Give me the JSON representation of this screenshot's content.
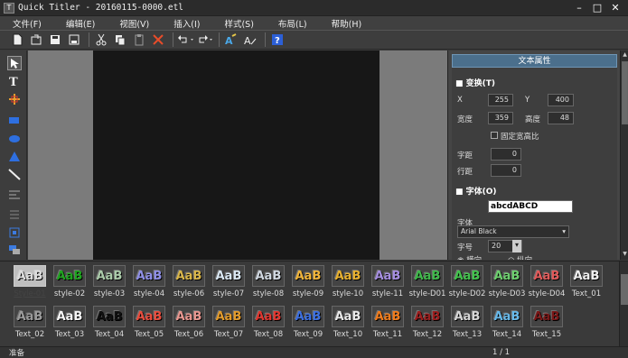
{
  "window": {
    "title": "Quick Titler - 20160115-0000.etl",
    "minimize": "–",
    "maximize": "□",
    "close": "✕"
  },
  "menu": [
    "文件(F)",
    "编辑(E)",
    "视图(V)",
    "插入(I)",
    "样式(S)",
    "布局(L)",
    "帮助(H)"
  ],
  "toolbar_icons": [
    "new-icon",
    "open-icon",
    "save-icon",
    "save-as-icon",
    "cut-icon",
    "copy-icon",
    "paste-icon",
    "delete-icon",
    "undo-icon",
    "redo-icon",
    "text-style-icon",
    "text-edit-icon",
    "help-icon"
  ],
  "left_tools": [
    "pointer-icon",
    "text-tool-icon",
    "crop-icon",
    "rectangle-icon",
    "ellipse-icon",
    "triangle-icon",
    "line-icon",
    "align-icon",
    "distribute-icon",
    "center-icon",
    "arrange-icon"
  ],
  "properties": {
    "header": "文本属性",
    "transform_section": "变换(T)",
    "x_label": "X",
    "x_value": "255",
    "y_label": "Y",
    "y_value": "400",
    "width_label": "宽度",
    "width_value": "359",
    "height_label": "高度",
    "height_value": "48",
    "fixed_ratio": "固定宽高比",
    "spacing_label": "字距",
    "spacing_value": "0",
    "line_label": "行距",
    "line_value": "0",
    "font_section": "字体(O)",
    "font_preview": "abcdABCD",
    "font_label": "字体",
    "font_value": "Arial Black",
    "size_label": "字号",
    "size_value": "20",
    "horizontal": "横向",
    "vertical": "纵向"
  },
  "styles_row1": [
    {
      "label": "Style-01",
      "text": "AaB",
      "color": "#dcdcdc",
      "selected": true
    },
    {
      "label": "style-02",
      "text": "AaB",
      "color": "#1fa31f"
    },
    {
      "label": "style-03",
      "text": "AaB",
      "color": "#aacaa9"
    },
    {
      "label": "style-04",
      "text": "AaB",
      "color": "#8f8fe6"
    },
    {
      "label": "style-06",
      "text": "AaB",
      "color": "#d9b64a"
    },
    {
      "label": "style-07",
      "text": "AaB",
      "color": "#d8e6f2"
    },
    {
      "label": "style-08",
      "text": "AaB",
      "color": "#cfd7e0"
    },
    {
      "label": "style-09",
      "text": "AaB",
      "color": "#f0b43a"
    },
    {
      "label": "style-10",
      "text": "AaB",
      "color": "#e7b02f"
    },
    {
      "label": "style-11",
      "text": "AaB",
      "color": "#a58de0"
    },
    {
      "label": "style-D01",
      "text": "AaB",
      "color": "#3fb84a"
    },
    {
      "label": "style-D02",
      "text": "AaB",
      "color": "#43c24d"
    },
    {
      "label": "style-D03",
      "text": "AaB",
      "color": "#6dcf6e"
    },
    {
      "label": "style-D04",
      "text": "AaB",
      "color": "#e05a5a"
    },
    {
      "label": "Text_01",
      "text": "AaB",
      "color": "#eeeeee"
    }
  ],
  "styles_row2": [
    {
      "label": "Text_02",
      "text": "AaB",
      "color": "#9a9a9a"
    },
    {
      "label": "Text_03",
      "text": "AaB",
      "color": "#f5f5f5"
    },
    {
      "label": "Text_04",
      "text": "AaB",
      "color": "#111111"
    },
    {
      "label": "Text_05",
      "text": "AaB",
      "color": "#e84c3d"
    },
    {
      "label": "Text_06",
      "text": "AaB",
      "color": "#e8968f"
    },
    {
      "label": "Text_07",
      "text": "AaB",
      "color": "#e29a2b"
    },
    {
      "label": "Text_08",
      "text": "AaB",
      "color": "#e0362f"
    },
    {
      "label": "Text_09",
      "text": "AaB",
      "color": "#3c6fe0"
    },
    {
      "label": "Text_10",
      "text": "AaB",
      "color": "#e9e9e9"
    },
    {
      "label": "Text_11",
      "text": "AaB",
      "color": "#ef7b1c"
    },
    {
      "label": "Text_12",
      "text": "AaB",
      "color": "#9b1e1e"
    },
    {
      "label": "Text_13",
      "text": "AaB",
      "color": "#d6d6d6"
    },
    {
      "label": "Text_14",
      "text": "AaB",
      "color": "#67b8e8"
    },
    {
      "label": "Text_15",
      "text": "AaB",
      "color": "#7a1717"
    }
  ],
  "status": {
    "left": "准备",
    "page": "1 / 1"
  }
}
